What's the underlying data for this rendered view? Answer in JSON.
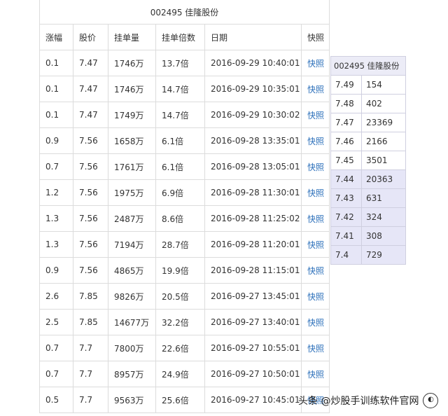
{
  "table": {
    "title": "002495  佳隆股份",
    "headers": [
      "涨幅",
      "股价",
      "挂单量",
      "挂单倍数",
      "日期",
      "快照"
    ],
    "rows": [
      [
        "0.1",
        "7.47",
        "1746万",
        "13.7倍",
        "2016-09-29 10:40:01",
        "快照"
      ],
      [
        "0.1",
        "7.47",
        "1746万",
        "14.7倍",
        "2016-09-29 10:35:01",
        "快照"
      ],
      [
        "0.1",
        "7.47",
        "1749万",
        "14.7倍",
        "2016-09-29 10:30:02",
        "快照"
      ],
      [
        "0.9",
        "7.56",
        "1658万",
        "6.1倍",
        "2016-09-28 13:35:01",
        "快照"
      ],
      [
        "0.7",
        "7.56",
        "1761万",
        "6.1倍",
        "2016-09-28 13:05:01",
        "快照"
      ],
      [
        "1.2",
        "7.56",
        "1975万",
        "6.9倍",
        "2016-09-28 11:30:01",
        "快照"
      ],
      [
        "1.3",
        "7.56",
        "2487万",
        "8.6倍",
        "2016-09-28 11:25:02",
        "快照"
      ],
      [
        "1.3",
        "7.56",
        "7194万",
        "28.7倍",
        "2016-09-28 11:20:01",
        "快照"
      ],
      [
        "0.9",
        "7.56",
        "4865万",
        "19.9倍",
        "2016-09-28 11:15:01",
        "快照"
      ],
      [
        "2.6",
        "7.85",
        "9826万",
        "20.5倍",
        "2016-09-27 13:45:01",
        "快照"
      ],
      [
        "2.5",
        "7.85",
        "14677万",
        "32.2倍",
        "2016-09-27 13:40:01",
        "快照"
      ],
      [
        "0.7",
        "7.7",
        "7800万",
        "22.6倍",
        "2016-09-27 10:55:01",
        "快照"
      ],
      [
        "0.7",
        "7.7",
        "8957万",
        "24.9倍",
        "2016-09-27 10:50:01",
        "快照"
      ],
      [
        "0.5",
        "7.7",
        "9563万",
        "25.6倍",
        "2016-09-27 10:45:01",
        "快照"
      ]
    ]
  },
  "order_book": {
    "title": "002495 佳隆股份",
    "asks": [
      [
        "7.49",
        "154"
      ],
      [
        "7.48",
        "402"
      ],
      [
        "7.47",
        "23369"
      ],
      [
        "7.46",
        "2166"
      ],
      [
        "7.45",
        "3501"
      ]
    ],
    "bids": [
      [
        "7.44",
        "20363"
      ],
      [
        "7.43",
        "631"
      ],
      [
        "7.42",
        "324"
      ],
      [
        "7.41",
        "308"
      ],
      [
        "7.4",
        "729"
      ]
    ]
  },
  "watermark": {
    "text": "头条 @炒股手训练软件官网"
  }
}
